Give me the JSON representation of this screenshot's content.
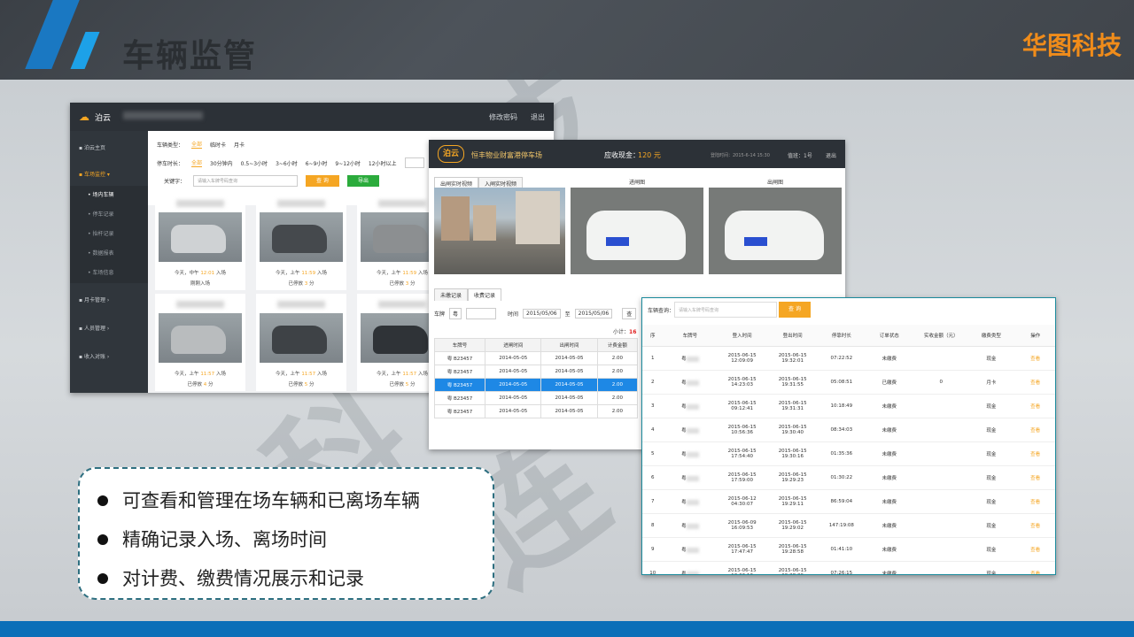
{
  "slide": {
    "title": "车辆监管",
    "brand": "华图科技",
    "watermark_chars": [
      "技",
      "科",
      "技",
      "连"
    ],
    "bullets": [
      "可查看和管理在场车辆和已离场车辆",
      "精确记录入场、离场时间",
      "对计费、缴费情况展示和记录"
    ],
    "colors": {
      "accent": "#f08c1a",
      "blue": "#0b6fb8"
    }
  },
  "window_a": {
    "logo": "泊云",
    "top_right": [
      "修改密码",
      "退出"
    ],
    "sidebar": [
      {
        "label": "泊云主页",
        "icon": "home-icon"
      },
      {
        "label": "车场监控",
        "icon": "monitor-icon"
      },
      {
        "label": "场内车辆"
      },
      {
        "label": "停车记录"
      },
      {
        "label": "抬杆记录"
      },
      {
        "label": "数据报表"
      },
      {
        "label": "车场信息"
      },
      {
        "label": "月卡管理",
        "icon": "card-icon"
      },
      {
        "label": "人员管理",
        "icon": "people-icon"
      },
      {
        "label": "收入对账",
        "icon": "money-icon"
      }
    ],
    "filter": {
      "type_label": "车辆类型：",
      "types": [
        "全部",
        "临时卡",
        "月卡"
      ],
      "duration_label": "停车时长：",
      "durations": [
        "全部",
        "30分钟内",
        "0.5~3小时",
        "3~6小时",
        "6~9小时",
        "9~12小时",
        "12小时以上"
      ],
      "keyword_label": "关键字：",
      "keyword_placeholder": "请输入车牌号码查询",
      "search_btn": "查 询",
      "export_btn": "导出"
    },
    "cards": [
      {
        "time_pre": "今天，中午",
        "time": "12:01",
        "time_post": "入场",
        "status": "刚刚入场",
        "minutes": ""
      },
      {
        "time_pre": "今天，上午",
        "time": "11:59",
        "time_post": "入场",
        "status": "已停放",
        "minutes": "3",
        "unit": "分"
      },
      {
        "time_pre": "今天，上午",
        "time": "11:59",
        "time_post": "入场",
        "status": "已停放",
        "minutes": "3",
        "unit": "分"
      },
      {
        "time_pre": "今天，上午",
        "time": "11:57",
        "time_post": "入场",
        "status": "已停放",
        "minutes": "4",
        "unit": "分"
      },
      {
        "time_pre": "今天，上午",
        "time": "11:57",
        "time_post": "入场",
        "status": "已停放",
        "minutes": "5",
        "unit": "分"
      },
      {
        "time_pre": "今天，上午",
        "time": "11:57",
        "time_post": "入场",
        "status": "已停放",
        "minutes": "5",
        "unit": "分"
      }
    ]
  },
  "window_b": {
    "logo": "泊云",
    "lot_name": "恒丰物业财富港停车场",
    "cash_label": "应收现金：",
    "cash_value": "120 元",
    "login_time": "登陆时间：2015-6-14  15:30",
    "post": "值班：1号",
    "exit": "退出",
    "video_tabs": [
      "出闸实时视频",
      "入闸实时视频"
    ],
    "img_labels": [
      "进闸图",
      "出闸图"
    ],
    "record_tabs": [
      "未缴记录",
      "收费记录"
    ],
    "plate_label": "车牌",
    "plate_prov": "粤",
    "time_label": "时间",
    "date_from": "2015/05/06",
    "to_label": "至",
    "date_to": "2015/05/06",
    "query_btn": "查",
    "subtotal_label": "小计：",
    "subtotal_value": "16",
    "columns": [
      "车牌号",
      "进闸时间",
      "出闸时间",
      "计费金额"
    ],
    "rows": [
      [
        "粤 B23457",
        "2014-05-05",
        "2014-05-05",
        "2.00"
      ],
      [
        "粤 B23457",
        "2014-05-05",
        "2014-05-05",
        "2.00"
      ],
      [
        "粤 B23457",
        "2014-05-05",
        "2014-05-05",
        "2.00"
      ],
      [
        "粤 B23457",
        "2014-05-05",
        "2014-05-05",
        "2.00"
      ],
      [
        "粤 B23457",
        "2014-05-05",
        "2014-05-05",
        "2.00"
      ]
    ],
    "selected_row": 2
  },
  "window_c": {
    "search_label": "车辆查询：",
    "search_placeholder": "请输入车牌号码查询",
    "search_btn": "查 询",
    "columns": [
      "序",
      "车牌号",
      "登入时间",
      "登出时间",
      "停靠时长",
      "订单状态",
      "实收金额（元）",
      "缴费类型",
      "操作"
    ],
    "rows": [
      [
        "1",
        "粤",
        "2015-06-15 12:09:09",
        "2015-06-15 19:32:01",
        "07:22:52",
        "未缴费",
        "",
        "现金",
        "查看"
      ],
      [
        "2",
        "粤",
        "2015-06-15 14:23:03",
        "2015-06-15 19:31:55",
        "05:08:51",
        "已缴费",
        "0",
        "月卡",
        "查看"
      ],
      [
        "3",
        "粤",
        "2015-06-15 09:12:41",
        "2015-06-15 19:31:31",
        "10:18:49",
        "未缴费",
        "",
        "现金",
        "查看"
      ],
      [
        "4",
        "粤",
        "2015-06-15 10:56:36",
        "2015-06-15 19:30:40",
        "08:34:03",
        "未缴费",
        "",
        "现金",
        "查看"
      ],
      [
        "5",
        "粤",
        "2015-06-15 17:54:40",
        "2015-06-15 19:30:16",
        "01:35:36",
        "未缴费",
        "",
        "现金",
        "查看"
      ],
      [
        "6",
        "粤",
        "2015-06-15 17:59:00",
        "2015-06-15 19:29:23",
        "01:30:22",
        "未缴费",
        "",
        "现金",
        "查看"
      ],
      [
        "7",
        "粤",
        "2015-06-12 04:30:07",
        "2015-06-15 19:29:11",
        "86:59:04",
        "未缴费",
        "",
        "现金",
        "查看"
      ],
      [
        "8",
        "粤",
        "2015-06-09 16:09:53",
        "2015-06-15 19:29:02",
        "147:19:08",
        "未缴费",
        "",
        "现金",
        "查看"
      ],
      [
        "9",
        "粤",
        "2015-06-15 17:47:47",
        "2015-06-15 19:28:58",
        "01:41:10",
        "未缴费",
        "",
        "现金",
        "查看"
      ],
      [
        "10",
        "粤",
        "2015-06-15 12:02:13",
        "2015-06-15 19:28:29",
        "07:26:15",
        "未缴费",
        "",
        "现金",
        "查看"
      ]
    ]
  }
}
